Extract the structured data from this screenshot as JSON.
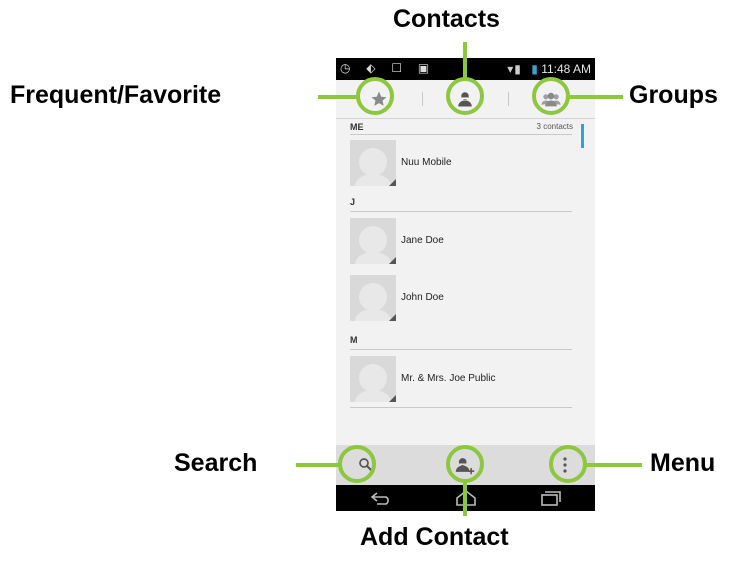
{
  "status_bar": {
    "left_icons": "◷ ⬖ ☐ ▣",
    "time": "11:48 AM"
  },
  "tabs": [
    {
      "name": "frequent-favorite",
      "icon": "star-icon"
    },
    {
      "name": "contacts",
      "icon": "person-icon"
    },
    {
      "name": "groups",
      "icon": "group-icon"
    }
  ],
  "sections": [
    {
      "header": "ME",
      "count": "3 contacts",
      "contacts": [
        "Nuu Mobile"
      ]
    },
    {
      "header": "J",
      "contacts": [
        "Jane Doe",
        "John Doe"
      ]
    },
    {
      "header": "M",
      "contacts": [
        "Mr. & Mrs. Joe Public"
      ]
    }
  ],
  "bottom_actions": [
    {
      "name": "search",
      "icon": "search-icon"
    },
    {
      "name": "add-contact",
      "icon": "add-person-icon"
    },
    {
      "name": "menu",
      "icon": "overflow-menu-icon"
    }
  ],
  "nav_buttons": [
    "back-icon",
    "home-icon",
    "recent-apps-icon"
  ],
  "callouts": {
    "contacts": "Contacts",
    "frequent_favorite": "Frequent/Favorite",
    "groups": "Groups",
    "search": "Search",
    "menu": "Menu",
    "add_contact": "Add Contact"
  },
  "colors": {
    "callout_green": "#8dc63f",
    "scroll_indicator": "#2ea3d8",
    "status_bar": "#000000"
  }
}
